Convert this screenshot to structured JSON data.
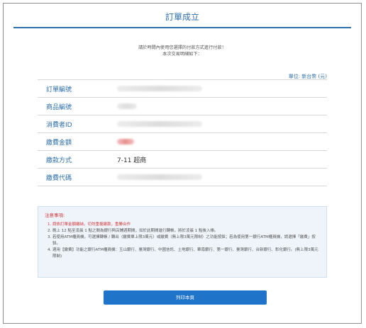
{
  "header": {
    "title": "訂單成立"
  },
  "intro": {
    "line1": "請於時間內使用您選擇的付款方式進行付款！",
    "line2": "本次交易明細如下："
  },
  "table": {
    "unit": "單位: 新台幣 (元)",
    "rows": [
      {
        "label": "訂單編號",
        "value": ""
      },
      {
        "label": "商品編號",
        "value": ""
      },
      {
        "label": "消費者ID",
        "value": ""
      },
      {
        "label": "繳費金額",
        "value": ""
      },
      {
        "label": "繳款方式",
        "value": "7-11 超商"
      },
      {
        "label": "繳費代碼",
        "value": ""
      }
    ]
  },
  "notes": {
    "title": "注意事項:",
    "items": [
      "請依訂單金額繳納，切勿重複繳款，重勝合作",
      "晚上 12 點至凌晨 1 點之間為銀行與店鋪週期間，如於此期間進行轉帳，將於凌晨 1 點後入帳。",
      "若使用ATM櫃員機，可選擇轉帳 / 轉出（繳費單上限3萬元）或繳費（無上限3萬元限制）之功能按鈕；若為使用第一銀行ATM櫃員機，請選擇「繳費」按鈕。",
      "適用【繳費】功能之銀行ATM櫃員機：玉山銀行、臺灣銀行、中國信託、土地銀行、華南銀行、第一銀行、臺灣銀行、台新銀行、彰化銀行。(無上限3萬元限制)"
    ]
  },
  "actions": {
    "print_label": "列印本頁"
  },
  "colors": {
    "accent": "#2d6fa8",
    "button": "#1f74c9",
    "warning": "#d03a3a",
    "notes_bg": "#eef4fa"
  }
}
